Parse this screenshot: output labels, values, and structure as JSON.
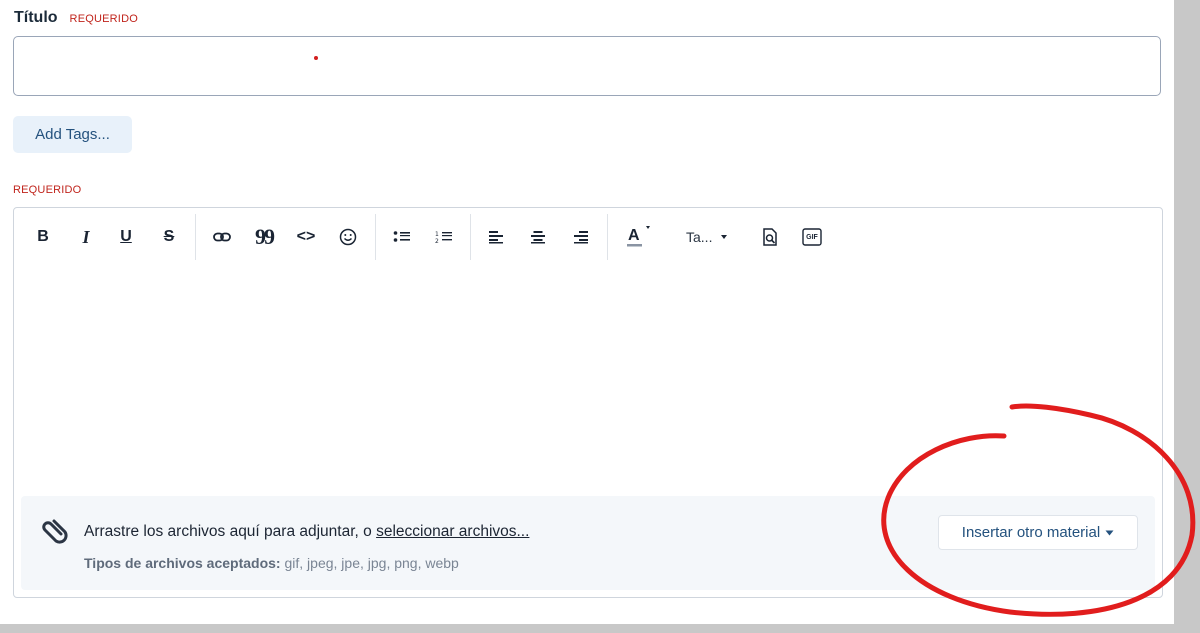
{
  "form": {
    "title_label": "Título",
    "title_required": "REQUERIDO",
    "add_tags_label": "Add Tags...",
    "body_required": "REQUERIDO"
  },
  "toolbar": {
    "bold": "B",
    "italic": "I",
    "underline": "U",
    "strike": "S",
    "quote": "99",
    "code": "<>",
    "font_size": "Ta...",
    "gif": "GIF"
  },
  "attachments": {
    "drop_text": "Arrastre los archivos aquí para adjuntar, o ",
    "select_link": "seleccionar archivos...",
    "types_label": "Tipos de archivos aceptados:",
    "types_value": "gif, jpeg, jpe, jpg, png, webp",
    "insert_button": "Insertar otro material"
  },
  "colors": {
    "required": "#c0241c",
    "accent": "#24527e",
    "annotation": "#e11d1d"
  }
}
